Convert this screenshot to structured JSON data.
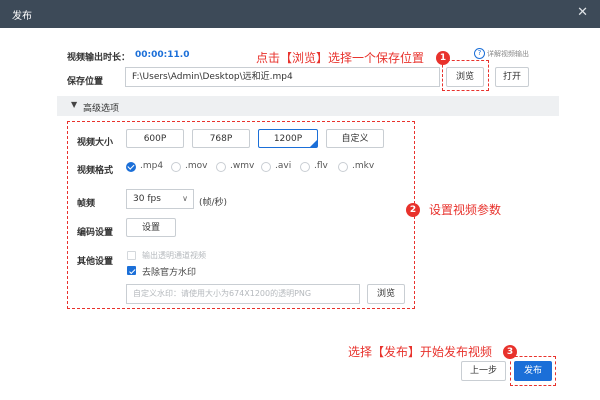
{
  "window": {
    "title": "发布",
    "close_glyph": "✕"
  },
  "duration": {
    "label": "视频输出时长：",
    "value": "00:00:11.0"
  },
  "help": {
    "icon": "help-icon",
    "text": "详解视频输出"
  },
  "save": {
    "label": "保存位置",
    "path": "F:\\Users\\Admin\\Desktop\\远和近.mp4",
    "browse_label": "浏览",
    "open_label": "打开"
  },
  "advanced": {
    "toggle_glyph": "▼",
    "label": "高级选项"
  },
  "size": {
    "label": "视频大小",
    "options": [
      "600P",
      "768P",
      "1200P",
      "自定义"
    ],
    "selected": "1200P"
  },
  "format": {
    "label": "视频格式",
    "options": [
      ".mp4",
      ".mov",
      ".wmv",
      ".avi",
      ".flv",
      ".mkv"
    ],
    "selected": ".mp4"
  },
  "fps": {
    "label": "帧频",
    "value": "30 fps",
    "arrow": "∨",
    "unit": "(帧/秒)"
  },
  "encode": {
    "label": "编码设置",
    "button": "设置"
  },
  "other": {
    "label": "其他设置",
    "transparent_label": "输出透明通道视频",
    "watermark_label": "去除官方水印",
    "watermark_checked": true,
    "custom_placeholder": "自定义水印：请使用大小为674X1200的透明PNG",
    "browse_label": "浏览"
  },
  "footer": {
    "prev_label": "上一步",
    "publish_label": "发布"
  },
  "annotations": {
    "step1": {
      "num": "1",
      "text": "点击【浏览】选择一个保存位置"
    },
    "step2": {
      "num": "2",
      "text": "设置视频参数"
    },
    "step3": {
      "num": "3",
      "text": "选择【发布】开始发布视频"
    }
  },
  "colors": {
    "title_bar": "#3d4a58",
    "accent": "#1b6fd8",
    "annotation": "#e8322c"
  }
}
